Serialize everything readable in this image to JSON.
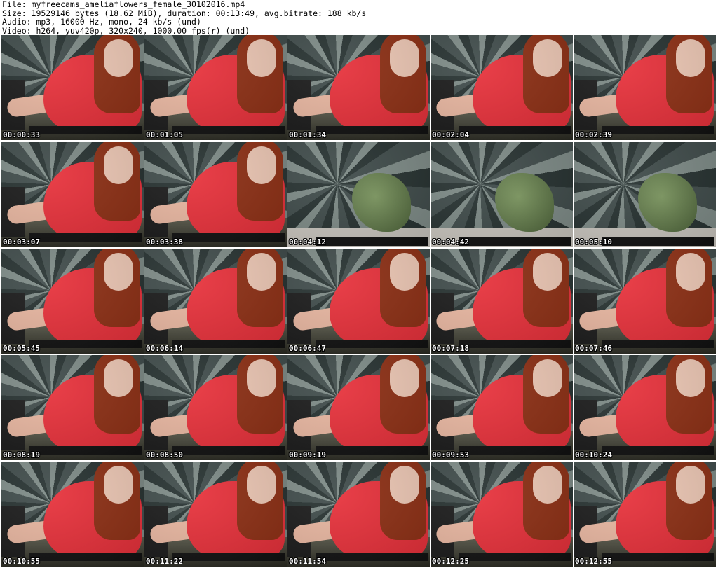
{
  "header": {
    "file": "File: myfreecams_ameliaflowers_female_30102016.mp4",
    "size": "Size: 19529146 bytes (18.62 MiB), duration: 00:13:49, avg.bitrate: 188 kb/s",
    "audio": "Audio: mp3, 16000 Hz, mono, 24 kb/s (und)",
    "video": "Video: h264, yuv420p, 320x240, 1000.00 fps(r) (und)"
  },
  "thumbnails": [
    {
      "time": "00:00:33",
      "scene": "person"
    },
    {
      "time": "00:01:05",
      "scene": "person"
    },
    {
      "time": "00:01:34",
      "scene": "person"
    },
    {
      "time": "00:02:04",
      "scene": "person"
    },
    {
      "time": "00:02:39",
      "scene": "person"
    },
    {
      "time": "00:03:07",
      "scene": "person"
    },
    {
      "time": "00:03:38",
      "scene": "person"
    },
    {
      "time": "00:04:12",
      "scene": "empty"
    },
    {
      "time": "00:04:42",
      "scene": "empty"
    },
    {
      "time": "00:05:10",
      "scene": "empty"
    },
    {
      "time": "00:05:45",
      "scene": "person"
    },
    {
      "time": "00:06:14",
      "scene": "person"
    },
    {
      "time": "00:06:47",
      "scene": "person"
    },
    {
      "time": "00:07:18",
      "scene": "person"
    },
    {
      "time": "00:07:46",
      "scene": "person"
    },
    {
      "time": "00:08:19",
      "scene": "person"
    },
    {
      "time": "00:08:50",
      "scene": "person"
    },
    {
      "time": "00:09:19",
      "scene": "person"
    },
    {
      "time": "00:09:53",
      "scene": "person"
    },
    {
      "time": "00:10:24",
      "scene": "person"
    },
    {
      "time": "00:10:55",
      "scene": "person"
    },
    {
      "time": "00:11:22",
      "scene": "person"
    },
    {
      "time": "00:11:54",
      "scene": "person"
    },
    {
      "time": "00:12:25",
      "scene": "person"
    },
    {
      "time": "00:12:55",
      "scene": "person"
    }
  ]
}
